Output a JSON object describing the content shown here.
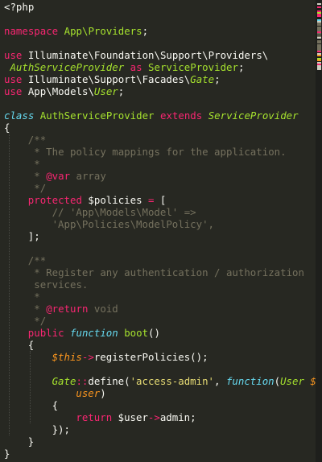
{
  "editor": {
    "language": "php",
    "theme": "monokai",
    "lines": [
      {
        "tokens": [
          [
            "php",
            "<?php"
          ]
        ]
      },
      {
        "tokens": []
      },
      {
        "tokens": [
          [
            "kw",
            "namespace"
          ],
          [
            "plain",
            " "
          ],
          [
            "cls",
            "App\\Providers"
          ],
          [
            "plain",
            ";"
          ]
        ]
      },
      {
        "tokens": []
      },
      {
        "tokens": [
          [
            "kw",
            "use"
          ],
          [
            "plain",
            " Illuminate\\Foundation\\Support\\Providers\\"
          ]
        ]
      },
      {
        "tokens": [
          [
            "clsi",
            "AuthServiceProvider"
          ],
          [
            "plain",
            " "
          ],
          [
            "kw",
            "as"
          ],
          [
            "plain",
            " "
          ],
          [
            "cls",
            "ServiceProvider"
          ],
          [
            "plain",
            ";"
          ]
        ],
        "indent": 1
      },
      {
        "tokens": [
          [
            "kw",
            "use"
          ],
          [
            "plain",
            " Illuminate\\Support\\Facades\\"
          ],
          [
            "clsi",
            "Gate"
          ],
          [
            "plain",
            ";"
          ]
        ]
      },
      {
        "tokens": [
          [
            "kw",
            "use"
          ],
          [
            "plain",
            " App\\Models\\"
          ],
          [
            "clsi",
            "User"
          ],
          [
            "plain",
            ";"
          ]
        ]
      },
      {
        "tokens": []
      },
      {
        "tokens": [
          [
            "storage",
            "class"
          ],
          [
            "plain",
            " "
          ],
          [
            "cls",
            "AuthServiceProvider"
          ],
          [
            "plain",
            " "
          ],
          [
            "kw",
            "extends"
          ],
          [
            "plain",
            " "
          ],
          [
            "clsi",
            "ServiceProvider"
          ]
        ]
      },
      {
        "tokens": [
          [
            "plain",
            "{"
          ]
        ]
      },
      {
        "tokens": [
          [
            "cmt",
            "/**"
          ]
        ],
        "indent": 4
      },
      {
        "tokens": [
          [
            "cmt",
            " * The policy mappings for the application."
          ]
        ],
        "indent": 4
      },
      {
        "tokens": [
          [
            "cmt",
            " *"
          ]
        ],
        "indent": 4
      },
      {
        "tokens": [
          [
            "cmt",
            " * "
          ],
          [
            "tag",
            "@var"
          ],
          [
            "typ",
            " array"
          ]
        ],
        "indent": 4
      },
      {
        "tokens": [
          [
            "cmt",
            " */"
          ]
        ],
        "indent": 4
      },
      {
        "tokens": [
          [
            "kw",
            "protected"
          ],
          [
            "plain",
            " $policies "
          ],
          [
            "op",
            "="
          ],
          [
            "plain",
            " ["
          ]
        ],
        "indent": 4
      },
      {
        "tokens": [
          [
            "cmt",
            "// 'App\\Models\\Model' =>"
          ]
        ],
        "indent": 8
      },
      {
        "tokens": [
          [
            "cmt",
            "'App\\Policies\\ModelPolicy',"
          ]
        ],
        "indent": 8
      },
      {
        "tokens": [
          [
            "plain",
            "];"
          ]
        ],
        "indent": 4
      },
      {
        "tokens": []
      },
      {
        "tokens": [
          [
            "cmt",
            "/**"
          ]
        ],
        "indent": 4
      },
      {
        "tokens": [
          [
            "cmt",
            " * Register any authentication / authorization"
          ]
        ],
        "indent": 4
      },
      {
        "tokens": [
          [
            "cmt",
            " services."
          ]
        ],
        "indent": 4
      },
      {
        "tokens": [
          [
            "cmt",
            " *"
          ]
        ],
        "indent": 4
      },
      {
        "tokens": [
          [
            "cmt",
            " * "
          ],
          [
            "tag",
            "@return"
          ],
          [
            "typ",
            " void"
          ]
        ],
        "indent": 4
      },
      {
        "tokens": [
          [
            "cmt",
            " */"
          ]
        ],
        "indent": 4
      },
      {
        "tokens": [
          [
            "kw",
            "public"
          ],
          [
            "plain",
            " "
          ],
          [
            "storage",
            "function"
          ],
          [
            "plain",
            " "
          ],
          [
            "fn",
            "boot"
          ],
          [
            "plain",
            "()"
          ]
        ],
        "indent": 4
      },
      {
        "tokens": [
          [
            "plain",
            "{"
          ]
        ],
        "indent": 4
      },
      {
        "tokens": [
          [
            "this",
            "$this"
          ],
          [
            "op",
            "->"
          ],
          [
            "plain",
            "registerPolicies();"
          ]
        ],
        "indent": 8
      },
      {
        "tokens": []
      },
      {
        "tokens": [
          [
            "clsi",
            "Gate"
          ],
          [
            "op",
            "::"
          ],
          [
            "plain",
            "define("
          ],
          [
            "str",
            "'access-admin'"
          ],
          [
            "plain",
            ", "
          ],
          [
            "storage",
            "function"
          ],
          [
            "plain",
            "("
          ],
          [
            "clsi",
            "User"
          ],
          [
            "plain",
            " "
          ],
          [
            "param",
            "$"
          ]
        ],
        "indent": 8
      },
      {
        "tokens": [
          [
            "param",
            "user"
          ],
          [
            "plain",
            ")"
          ]
        ],
        "indent": 12
      },
      {
        "tokens": [
          [
            "plain",
            "{"
          ]
        ],
        "indent": 8
      },
      {
        "tokens": [
          [
            "kw",
            "return"
          ],
          [
            "plain",
            " $user"
          ],
          [
            "op",
            "->"
          ],
          [
            "plain",
            "admin;"
          ]
        ],
        "indent": 12
      },
      {
        "tokens": [
          [
            "plain",
            "});"
          ]
        ],
        "indent": 8
      },
      {
        "tokens": [
          [
            "plain",
            "}"
          ]
        ],
        "indent": 4
      },
      {
        "tokens": [
          [
            "plain",
            "}"
          ]
        ]
      }
    ]
  }
}
